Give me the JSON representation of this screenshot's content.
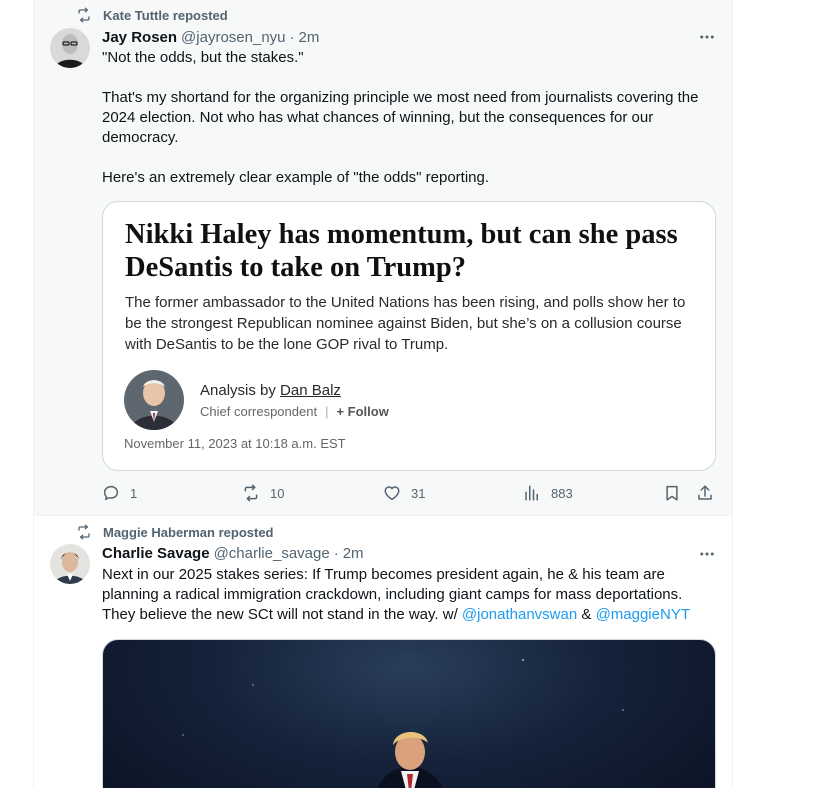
{
  "tweets": [
    {
      "repost_label": "Kate Tuttle reposted",
      "author_name": "Jay Rosen",
      "handle": "@jayrosen_nyu",
      "separator": "·",
      "time": "2m",
      "body": [
        "\"Not the odds, but the stakes.\"",
        "That's my shortand for the organizing principle we most need from journalists covering the 2024 election. Not who has what chances of winning, but the consequences for our democracy.",
        "Here's an extremely clear example of \"the odds\" reporting."
      ],
      "card": {
        "headline": "Nikki Haley has momentum, but can she pass DeSantis to take on Trump?",
        "dek": "The former ambassador to the United Nations has been rising, and polls show her to be the strongest Republican nominee against Biden, but she’s on a collusion course with DeSantis to be the lone GOP rival to Trump.",
        "byline_prefix": "Analysis by ",
        "byline_author": "Dan Balz",
        "author_role": "Chief correspondent",
        "role_separator": "|",
        "follow_label": "+ Follow",
        "dateline": "November 11, 2023 at 10:18 a.m. EST"
      },
      "stats": {
        "replies": "1",
        "reposts": "10",
        "likes": "31",
        "views": "883"
      }
    },
    {
      "repost_label": "Maggie Haberman reposted",
      "author_name": "Charlie Savage",
      "handle": "@charlie_savage",
      "separator": "·",
      "time": "2m",
      "body_text": "Next in our 2025 stakes series: If Trump becomes president again, he & his team are planning a radical immigration crackdown, including giant camps for mass deportations. They believe the new SCt will not stand in the way. w/ ",
      "mention_1": "@jonathanvswan",
      "mention_join": " & ",
      "mention_2": "@maggieNYT"
    }
  ],
  "icons": {
    "repost": "repost-icon",
    "more": "more-icon",
    "reply": "reply-icon",
    "like": "like-icon",
    "views": "views-icon",
    "bookmark": "bookmark-icon",
    "share": "share-icon"
  },
  "colors": {
    "link": "#1d9bf0",
    "secondary_text": "#536471",
    "border": "#cfd9de",
    "hover_background": "#f7f9f9"
  }
}
